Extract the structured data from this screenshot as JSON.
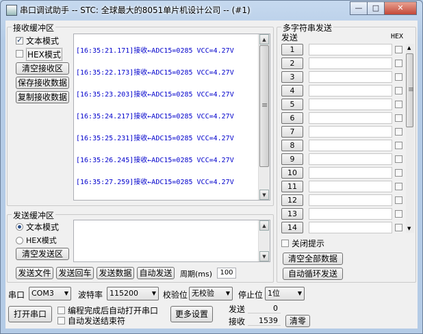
{
  "window": {
    "title": "串口调试助手 -- STC: 全球最大的8051单片机设计公司 -- (#1)",
    "min_glyph": "—",
    "max_glyph": "□",
    "close_glyph": "✕"
  },
  "receive": {
    "group_label": "接收缓冲区",
    "text_mode_label": "文本模式",
    "text_mode_checked": true,
    "hex_mode_label": "HEX模式",
    "hex_mode_checked": false,
    "clear_label": "清空接收区",
    "save_label": "保存接收数据",
    "copy_label": "复制接收数据",
    "lines": [
      "[16:35:21.171]接收←ADC15=0285  VCC=4.27V",
      "[16:35:22.173]接收←ADC15=0285  VCC=4.27V",
      "[16:35:23.203]接收←ADC15=0285  VCC=4.27V",
      "[16:35:24.217]接收←ADC15=0285  VCC=4.27V",
      "[16:35:25.231]接收←ADC15=0285  VCC=4.27V",
      "[16:35:26.245]接收←ADC15=0285  VCC=4.27V",
      "[16:35:27.259]接收←ADC15=0285  VCC=4.27V"
    ]
  },
  "send": {
    "group_label": "发送缓冲区",
    "text_mode_label": "文本模式",
    "hex_mode_label": "HEX模式",
    "mode_selected": "text",
    "clear_label": "清空发送区",
    "input_value": ""
  },
  "send_actions": {
    "send_file": "发送文件",
    "send_enter": "发送回车",
    "send_data": "发送数据",
    "auto_send": "自动发送",
    "period_label": "周期(ms)",
    "period_value": "100"
  },
  "multi": {
    "group_label": "多字符串发送",
    "send_header": "发送",
    "hex_header": "HEX",
    "rows": [
      "1",
      "2",
      "3",
      "4",
      "5",
      "6",
      "7",
      "8",
      "9",
      "10",
      "11",
      "12",
      "13",
      "14"
    ],
    "close_hint_label": "关闭提示",
    "clear_all_label": "清空全部数据",
    "auto_loop_label": "自动循环发送"
  },
  "serial": {
    "port_label": "串口",
    "port_value": "COM3",
    "baud_label": "波特率",
    "baud_value": "115200",
    "parity_label": "校验位",
    "parity_value": "无校验",
    "stop_label": "停止位",
    "stop_value": "1位",
    "open_button": "打开串口",
    "auto_open_label": "编程完成后自动打开串口",
    "auto_end_label": "自动发送结束符",
    "more_settings": "更多设置",
    "sent_label": "发送",
    "sent_value": "0",
    "recv_label": "接收",
    "recv_value": "1539",
    "clear_counts": "清零"
  },
  "colors": {
    "log_text": "#0000cc",
    "window_frame": "#b4cbe6",
    "close_button": "#c4493a"
  }
}
